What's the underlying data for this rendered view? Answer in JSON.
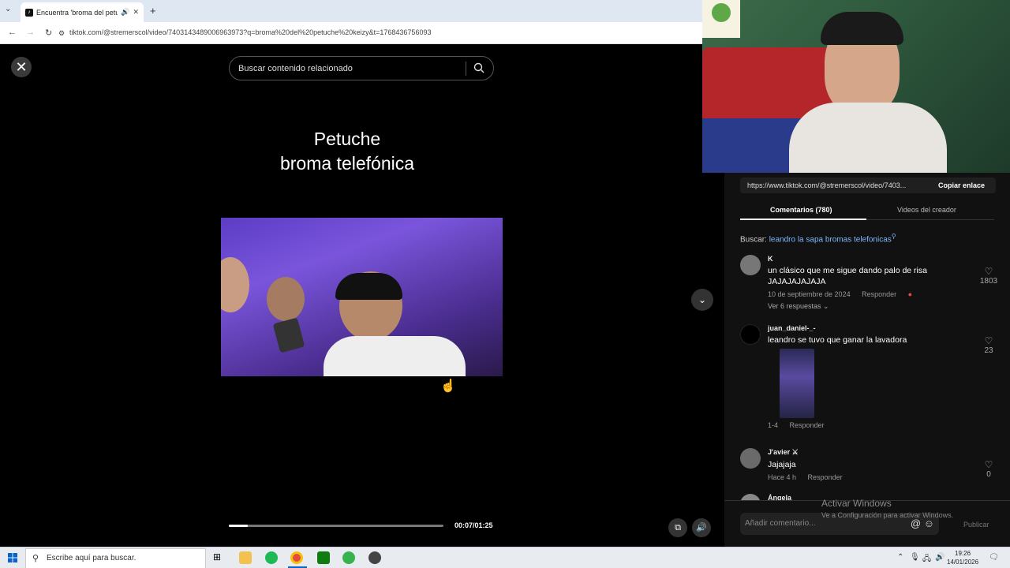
{
  "browser": {
    "tab_title": "Encuentra 'broma del petu",
    "url": "tiktok.com/@stremerscol/video/7403143489006963973?q=broma%20del%20petuche%20keizy&t=1768436756093",
    "new_tab": "+"
  },
  "video": {
    "search_placeholder": "Buscar contenido relacionado",
    "title_line1": "Petuche",
    "title_line2": "broma telefónica",
    "current_time": "00:07/01:25",
    "progress": 0.09
  },
  "panel": {
    "link": "https://www.tiktok.com/@stremerscol/video/7403...",
    "copy_label": "Copiar enlace",
    "tab_comments": "Comentarios (780)",
    "tab_creator": "Videos del creador",
    "search_prefix": "Buscar:",
    "search_query": "leandro la sapa bromas telefonicas",
    "comments": [
      {
        "user": "K",
        "text": "un clásico que me sigue dando palo de risa JAJAJAJAJAJA",
        "date": "10 de septiembre de 2024",
        "reply": "Responder",
        "replies": "Ver 6 respuestas",
        "likes": "1803"
      },
      {
        "user": "juan_daniel-_-",
        "text": "leandro se tuvo que ganar la lavadora",
        "date": "1-4",
        "reply": "Responder",
        "likes": "23"
      },
      {
        "user": "J'avier ⚔",
        "text": "Jajajaja",
        "date": "Hace 4 h",
        "reply": "Responder",
        "likes": "0"
      },
      {
        "user": "Ángela"
      }
    ],
    "add_comment_placeholder": "Añadir comentario...",
    "publish": "Publicar"
  },
  "watermark": {
    "line1": "Activar Windows",
    "line2": "Ve a Configuración para activar Windows."
  },
  "taskbar": {
    "search_placeholder": "Escribe aquí para buscar.",
    "time": "19:26",
    "date": "14/01/2026"
  },
  "colors": {
    "accent_link": "#7db7ff",
    "video_bg": "#000000",
    "panel_bg": "#111111"
  }
}
